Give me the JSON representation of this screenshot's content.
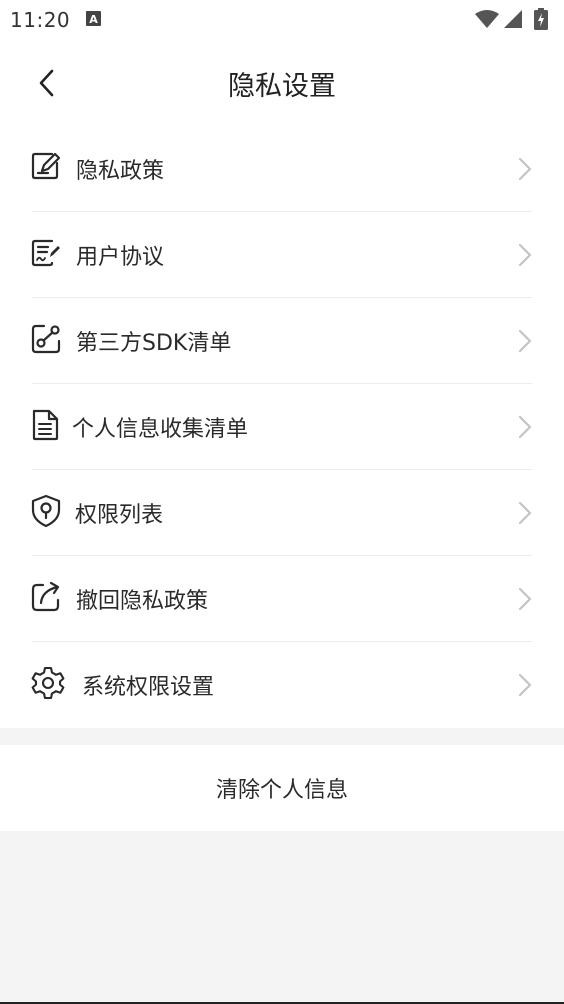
{
  "status_bar": {
    "time": "11:20",
    "icons": [
      "text-a-icon",
      "wifi-icon",
      "signal-icon",
      "battery-charging-icon"
    ]
  },
  "nav": {
    "back_icon": "chevron-left-icon",
    "title": "隐私设置"
  },
  "menu": {
    "items": [
      {
        "label": "隐私政策",
        "icon": "edit-note-icon"
      },
      {
        "label": "用户协议",
        "icon": "document-sign-icon"
      },
      {
        "label": "第三方SDK清单",
        "icon": "share-link-icon"
      },
      {
        "label": "个人信息收集清单",
        "icon": "file-list-icon"
      },
      {
        "label": "权限列表",
        "icon": "shield-location-icon"
      },
      {
        "label": "撤回隐私政策",
        "icon": "share-arrow-icon"
      },
      {
        "label": "系统权限设置",
        "icon": "gear-icon"
      }
    ],
    "chevron_icon": "chevron-right-icon"
  },
  "clear": {
    "label": "清除个人信息"
  },
  "colors": {
    "background": "#f4f4f4",
    "surface": "#ffffff",
    "text": "#2a2a2a",
    "divider": "#ececec",
    "chevron": "#c4c4c4"
  }
}
